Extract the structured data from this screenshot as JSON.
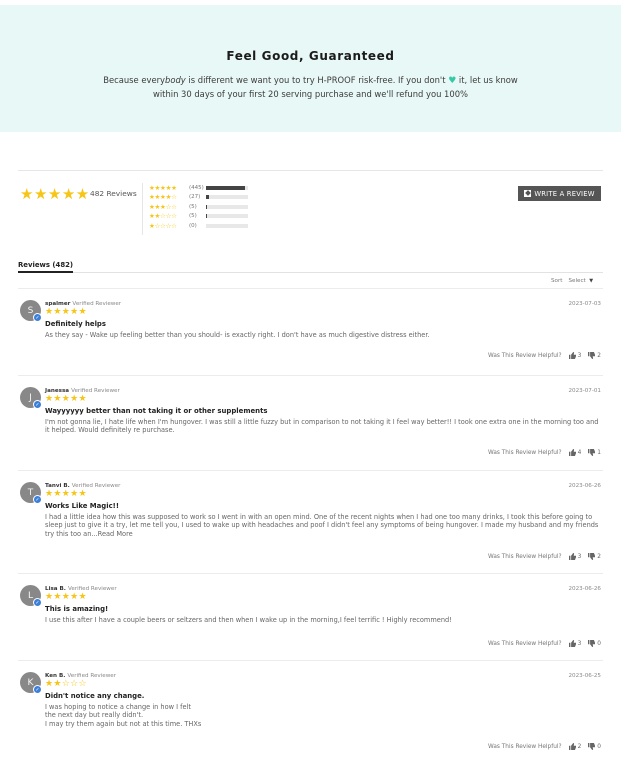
{
  "guarantee": {
    "title": "Feel Good, Guaranteed",
    "text_pre": "Because every",
    "text_em": "body",
    "text_mid": " is different we want you to try H-PROOF risk-free. If you don't ",
    "text_post": " it, let us know within 30 days of your first 20 serving purchase and we'll refund you 100%",
    "heart_icon": "heart-icon",
    "heart_color": "#35c9a7"
  },
  "summary": {
    "average_stars": "★★★★★",
    "total_label": "482 Reviews",
    "histogram": [
      {
        "stars": "★★★★★",
        "count": "(445)",
        "fraction": 0.92
      },
      {
        "stars": "★★★★☆",
        "count": "(27)",
        "fraction": 0.06
      },
      {
        "stars": "★★★☆☆",
        "count": "(5)",
        "fraction": 0.01
      },
      {
        "stars": "★★☆☆☆",
        "count": "(5)",
        "fraction": 0.01
      },
      {
        "stars": "★☆☆☆☆",
        "count": "(0)",
        "fraction": 0.0
      }
    ],
    "write_review_label": "WRITE A REVIEW"
  },
  "tabs": {
    "reviews_label": "Reviews (482)"
  },
  "sort": {
    "label": "Sort",
    "selected": "Select",
    "caret": "▼"
  },
  "helpful_label": "Was This Review Helpful?",
  "reviews": [
    {
      "initial": "S",
      "name": "spalmer",
      "badge": "Verified Reviewer",
      "date": "2023-07-03",
      "stars": "★★★★★",
      "title": "Definitely helps",
      "body": "As they say - Wake up feeling better than you should- is exactly right. I don't have as much digestive distress either.",
      "up": "3",
      "down": "2"
    },
    {
      "initial": "J",
      "name": "Janessa",
      "badge": "Verified Reviewer",
      "date": "2023-07-01",
      "stars": "★★★★★",
      "title": "Wayyyyyy better than not taking it or other supplements",
      "body": "I'm not gonna lie, I hate life when I'm hungover. I was still a little fuzzy but in comparison to not taking it I feel way better!! I took one extra one in the morning too and it helped. Would definitely re purchase.",
      "up": "4",
      "down": "1"
    },
    {
      "initial": "T",
      "name": "Tanvi B.",
      "badge": "Verified Reviewer",
      "date": "2023-06-26",
      "stars": "★★★★★",
      "title": "Works Like Magic!!",
      "body": "I had a little idea how this was supposed to work so I went in with an open mind. One of the recent nights when I had one too many drinks, I took this before going to sleep just to give it a try, let me tell you, I used to wake up with headaches and poof I didn't feel any symptoms of being hungover. I made my husband and my friends try this too an...Read More",
      "up": "3",
      "down": "2"
    },
    {
      "initial": "L",
      "name": "Lisa B.",
      "badge": "Verified Reviewer",
      "date": "2023-06-26",
      "stars": "★★★★★",
      "title": "This is amazing!",
      "body": "I use this after I have a couple beers or seltzers and then when I wake up in the morning,I feel terrific ! Highly recommend!",
      "up": "3",
      "down": "0"
    },
    {
      "initial": "K",
      "name": "Ken B.",
      "badge": "Verified Reviewer",
      "date": "2023-06-25",
      "stars": "★★☆☆☆",
      "title": "Didn't notice any change.",
      "body": "I was hoping to notice a change in how I felt\nthe next day but really didn't.\nI may try them again but not at this time. THXs",
      "up": "2",
      "down": "0"
    }
  ]
}
